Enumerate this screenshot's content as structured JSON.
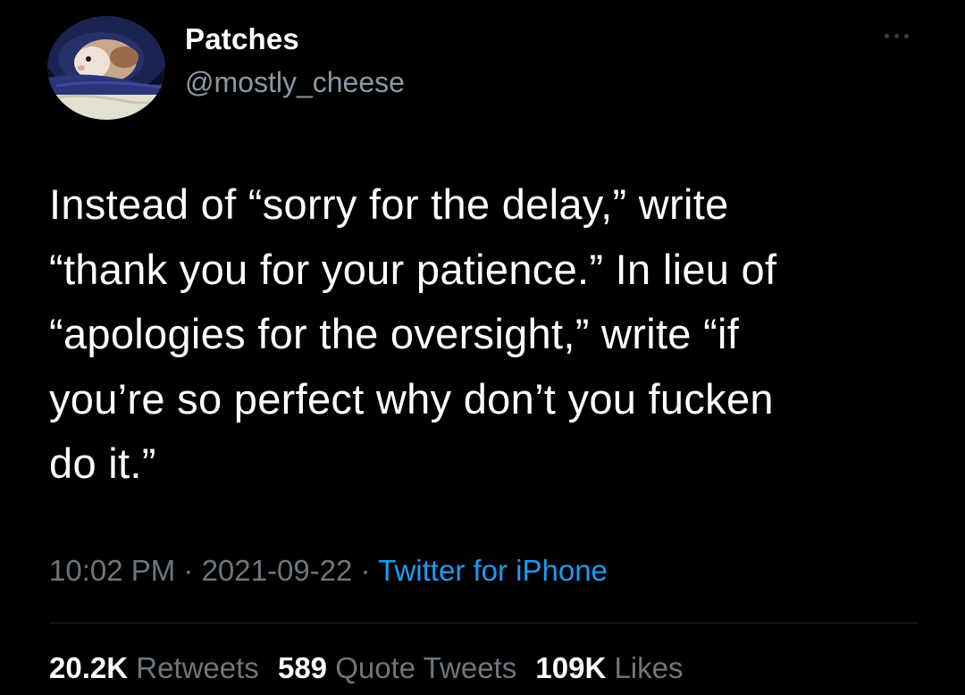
{
  "author": {
    "display_name": "Patches",
    "handle": "@mostly_cheese",
    "avatar_icon": "guinea-pig-in-blanket-avatar"
  },
  "more_icon": "ellipsis-icon",
  "tweet": {
    "text": "Instead of “sorry for the delay,” write\n“thank you for your patience.” In lieu of\n“apologies for the oversight,” write “if\nyou’re so perfect why don’t you fucken\ndo it.”"
  },
  "meta": {
    "time": "10:02 PM",
    "date": "2021-09-22",
    "separator": " · ",
    "source": "Twitter for iPhone"
  },
  "stats": {
    "retweets_count": "20.2K",
    "retweets_label": "Retweets",
    "quotes_count": "589",
    "quotes_label": "Quote Tweets",
    "likes_count": "109K",
    "likes_label": "Likes"
  },
  "colors": {
    "background": "#000000",
    "text_primary": "#ffffff",
    "text_secondary": "#6e767d",
    "link": "#1d9bf0"
  }
}
